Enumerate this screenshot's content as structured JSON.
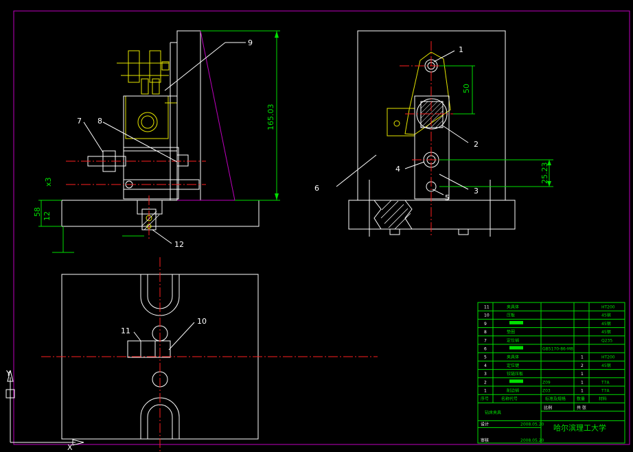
{
  "drawing": {
    "dimensions": {
      "height_total": "165.03",
      "dim_50": "50",
      "dim_25_23": "25.23",
      "dim_12": "12",
      "dim_x3": "x3",
      "dim_small": "58"
    },
    "balloons": [
      "1",
      "2",
      "3",
      "4",
      "5",
      "6",
      "7",
      "8",
      "9",
      "10",
      "11",
      "12"
    ],
    "title_block": {
      "school": "哈尔滨理工大学",
      "rows": [
        {
          "no": "",
          "name": "夹具体",
          "code": "",
          "qty": "",
          "mat": "HT200"
        },
        {
          "no": "",
          "name": "压板",
          "code": "",
          "qty": "",
          "mat": "45钢"
        },
        {
          "no": "",
          "name": "",
          "code": "",
          "qty": "",
          "mat": "45钢"
        },
        {
          "no": "",
          "name": "垫圈",
          "code": "",
          "qty": "",
          "mat": "45钢"
        },
        {
          "no": "",
          "name": "定位销",
          "code": "",
          "qty": "",
          "mat": "Q235"
        },
        {
          "no": "",
          "name": "",
          "code": "GB5170-86-M8",
          "qty": "",
          "mat": ""
        },
        {
          "no": "",
          "name": "夹具体",
          "code": "",
          "qty": "1",
          "mat": "HT200"
        },
        {
          "no": "",
          "name": "定位键",
          "code": "",
          "qty": "2",
          "mat": "45钢"
        },
        {
          "no": "",
          "name": "铰链压板",
          "code": "",
          "qty": "1",
          "mat": ""
        },
        {
          "no": "",
          "name": "",
          "code": "Z09",
          "qty": "1",
          "mat": "T7A"
        },
        {
          "no": "",
          "name": "削边销",
          "code": "Z03",
          "qty": "1",
          "mat": "T7A"
        }
      ],
      "header": {
        "no": "序号",
        "name": "名称代号",
        "code": "标准及规格",
        "qty": "数量",
        "mat": "材料"
      },
      "sub_title": "钻床夹具",
      "scale_label": "比例",
      "sheet_label": "共 张",
      "design_label": "设计",
      "check_label": "审核",
      "date1": "2008.05.20",
      "date2": "2008.05.20"
    }
  }
}
